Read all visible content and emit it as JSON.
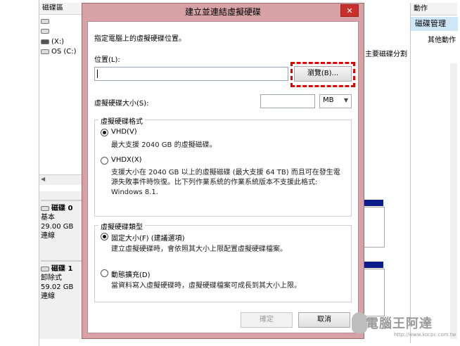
{
  "background_app": {
    "volume_column_header": "磁碟區",
    "volumes": [
      "",
      "",
      "(X:)",
      "OS (C:)"
    ],
    "right_text": "主要磁碟分割",
    "disks": [
      {
        "title": "磁碟 0",
        "type": "基本",
        "size": "29.00 GB",
        "status": "連線"
      },
      {
        "title": "磁碟 1",
        "type": "卸除式",
        "size": "59.02 GB",
        "status": "連線"
      }
    ],
    "actions": {
      "header": "動作",
      "selected": "磁碟管理",
      "more": "其他動作"
    }
  },
  "dialog": {
    "title": "建立並連結虛擬硬碟",
    "close_label": "✕",
    "instruction": "指定電腦上的虛擬硬碟位置。",
    "location_label": "位置(L):",
    "location_value": "",
    "browse_label": "瀏覽(B)...",
    "size_label": "虛擬硬碟大小(S):",
    "size_value": "",
    "size_unit": "MB",
    "format_group": {
      "title": "虛擬硬碟格式",
      "options": [
        {
          "label": "VHD(V)",
          "selected": true,
          "desc": [
            "最大支援 2040 GB 的虛擬磁碟。"
          ]
        },
        {
          "label": "VHDX(X)",
          "selected": false,
          "desc": [
            "支援大小在 2040 GB 以上的虛擬磁碟 (最大支援 64 TB) 而且可在發生電",
            "源失敗事件時恢復。比下列作業系統的作業系統版本不支援此格式:",
            "Windows 8.1."
          ]
        }
      ]
    },
    "type_group": {
      "title": "虛擬硬碟類型",
      "options": [
        {
          "label": "固定大小(F) (建議選項)",
          "selected": true,
          "desc": "建立虛擬硬碟時，會依照其大小上限配置虛擬硬碟檔案。"
        },
        {
          "label": "動態擴充(D)",
          "selected": false,
          "desc": "當資料寫入虛擬硬碟時，虛擬硬碟檔案可成長到其大小上限。"
        }
      ]
    },
    "ok_label": "確定",
    "cancel_label": "取消"
  },
  "watermark": {
    "text": "電腦王阿達",
    "url": "http://www.kocpc.com.tw"
  },
  "colors": {
    "dialog_frame": "#d6a2a6",
    "close_button": "#c7302b",
    "highlight": "#e60000",
    "selection": "#cfe6f7"
  }
}
